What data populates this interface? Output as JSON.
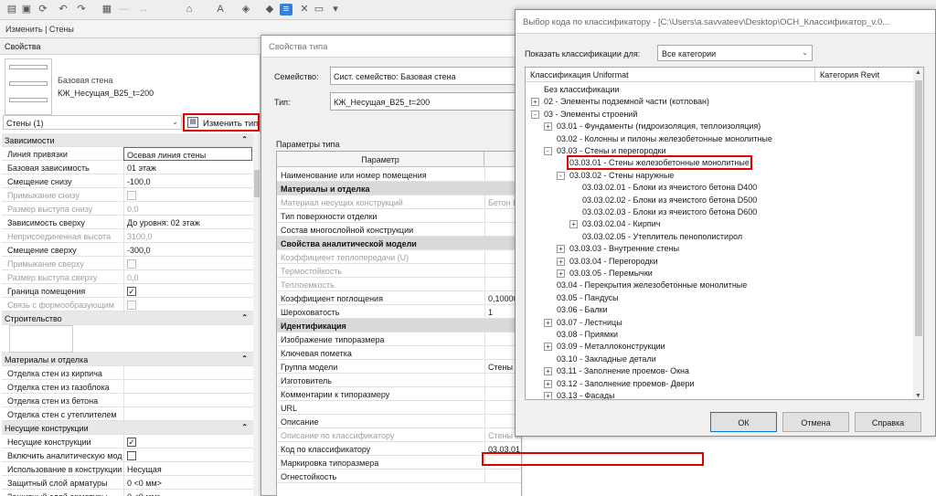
{
  "toolbar": {
    "icons": [
      "open-icon",
      "save-icon",
      "sync-icon",
      "undo-icon",
      "redo-icon",
      "print-icon",
      "measure-icon",
      "dimension-icon",
      "tag-icon",
      "text-icon",
      "3d-icon",
      "section-icon",
      "thin-lines-icon",
      "close-hidden-icon",
      "switch-windows-icon",
      "dropdown-icon"
    ]
  },
  "ribbon": {
    "label": "Изменить | Стены"
  },
  "properties": {
    "title": "Свойства",
    "family": "Базовая стена",
    "type_name": "КЖ_Несущая_B25_t=200",
    "instance_selector": "Стены (1)",
    "edit_type_label": "Изменить тип",
    "rows": [
      {
        "kind": "section",
        "label": "Зависимости",
        "arrow": "⌃"
      },
      {
        "label": "Линия привязки",
        "value": "Осевая линия стены",
        "boxed": true
      },
      {
        "label": "Базовая зависимость",
        "value": "01 этаж"
      },
      {
        "label": "Смещение снизу",
        "value": "-100,0"
      },
      {
        "label": "Примыкание снизу",
        "value": "",
        "dim": true,
        "check": "dis"
      },
      {
        "label": "Размер выступа снизу",
        "value": "0,0",
        "dim": true
      },
      {
        "label": "Зависимость сверху",
        "value": "До уровня: 02 этаж"
      },
      {
        "label": "Неприсоединенная высота",
        "value": "3100,0",
        "dim": true
      },
      {
        "label": "Смещение сверху",
        "value": "-300,0"
      },
      {
        "label": "Примыкание сверху",
        "value": "",
        "dim": true,
        "check": "dis"
      },
      {
        "label": "Размер выступа сверху",
        "value": "0,0",
        "dim": true
      },
      {
        "label": "Граница помещения",
        "value": "✓",
        "check": "on"
      },
      {
        "label": "Связь с формообразующим",
        "value": "",
        "dim": true,
        "check": "dis"
      },
      {
        "kind": "section",
        "label": "Строительство",
        "arrow": "⌃"
      },
      {
        "kind": "thumb"
      },
      {
        "kind": "section",
        "label": "Материалы и отделка",
        "arrow": "⌃"
      },
      {
        "label": "Отделка стен из кирпича",
        "value": ""
      },
      {
        "label": "Отделка стен из газоблока",
        "value": ""
      },
      {
        "label": "Отделка стен из бетона",
        "value": ""
      },
      {
        "label": "Отделка стен с утеплителем",
        "value": ""
      },
      {
        "kind": "section",
        "label": "Несущие конструкции",
        "arrow": "⌃"
      },
      {
        "label": "Несущие конструкции",
        "value": "✓",
        "check": "on"
      },
      {
        "label": "Включить аналитическую модель",
        "value": "",
        "check": "off"
      },
      {
        "label": "Использование в конструкции",
        "value": "Несущая"
      },
      {
        "label": "Защитный слой арматуры",
        "value": "0 <0 мм>"
      },
      {
        "label": "Защитный слой арматуры",
        "value": "0 <0 мм>"
      }
    ]
  },
  "type_dialog": {
    "title": "Свойства типа",
    "family_label": "Семейство:",
    "family_value": "Сист. семейство: Базовая стена",
    "type_label": "Тип:",
    "type_value": "КЖ_Несущая_B25_t=200",
    "params_label": "Параметры типа",
    "col_param": "Параметр",
    "rows": [
      {
        "label": "Наименование или номер помещения",
        "value": ""
      },
      {
        "kind": "section",
        "label": "Материалы и отделка"
      },
      {
        "label": "Материал несущих конструкций",
        "value": "Бетон Б",
        "dim": true
      },
      {
        "label": "Тип поверхности отделки",
        "value": ""
      },
      {
        "label": "Состав многослойной конструкции",
        "value": ""
      },
      {
        "kind": "section",
        "label": "Свойства аналитической модели"
      },
      {
        "label": "Коэффициент теплопередачи (U)",
        "value": "",
        "dim": true
      },
      {
        "label": "Термостойкость",
        "value": "",
        "dim": true
      },
      {
        "label": "Теплоемкость",
        "value": "",
        "dim": true
      },
      {
        "label": "Коэффициент поглощения",
        "value": "0,10000"
      },
      {
        "label": "Шероховатость",
        "value": "1"
      },
      {
        "kind": "section",
        "label": "Идентификация"
      },
      {
        "label": "Изображение типоразмера",
        "value": ""
      },
      {
        "label": "Ключевая пометка",
        "value": ""
      },
      {
        "label": "Группа модели",
        "value": "Стены"
      },
      {
        "label": "Изготовитель",
        "value": ""
      },
      {
        "label": "Комментарии к типоразмеру",
        "value": ""
      },
      {
        "label": "URL",
        "value": ""
      },
      {
        "label": "Описание",
        "value": ""
      },
      {
        "label": "Описание по классификатору",
        "value": "Стены железобетонные монолитные",
        "dim": true,
        "wide": true
      },
      {
        "label": "Код по классификатору",
        "value": "03.03.01",
        "wide": true
      },
      {
        "label": "Маркировка типоразмера",
        "value": ""
      },
      {
        "label": "Огнестойкость",
        "value": ""
      }
    ]
  },
  "classifier_dialog": {
    "title": "Выбор кода по классификатору - [C:\\Users\\a.savvateev\\Desktop\\ОСН_Классификатор_v.0...",
    "show_label": "Показать классификации для:",
    "category_value": "Все категории",
    "col_uniformat": "Классификация Uniformat",
    "col_category": "Категория Revit",
    "tree": [
      {
        "label": "Без классификации",
        "level": 0,
        "exp": ""
      },
      {
        "label": "02 - Элементы подземной части (котлован)",
        "level": 0,
        "exp": "+"
      },
      {
        "label": "03 - Элементы строений",
        "level": 0,
        "exp": "-"
      },
      {
        "label": "03.01 - Фундаменты (гидроизоляция, теплоизоляция)",
        "level": 1,
        "exp": "+"
      },
      {
        "label": "03.02 - Колонны и пилоны железобетонные монолитные",
        "level": 1,
        "exp": ""
      },
      {
        "label": "03.03 - Стены и перегородки",
        "level": 1,
        "exp": "-"
      },
      {
        "label": "03.03.01 - Стены железобетонные монолитные",
        "level": 2,
        "exp": "",
        "selected": true
      },
      {
        "label": "03.03.02 - Стены наружные",
        "level": 2,
        "exp": "-"
      },
      {
        "label": "03.03.02.01 - Блоки из ячеистого бетона D400",
        "level": 3,
        "exp": ""
      },
      {
        "label": "03.03.02.02 - Блоки из ячеистого бетона D500",
        "level": 3,
        "exp": ""
      },
      {
        "label": "03.03.02.03 - Блоки из ячеистого бетона D600",
        "level": 3,
        "exp": ""
      },
      {
        "label": "03.03.02.04 - Кирпич",
        "level": 3,
        "exp": "+"
      },
      {
        "label": "03.03.02.05 - Утеплитель пенополистирол",
        "level": 3,
        "exp": ""
      },
      {
        "label": "03.03.03 - Внутренние стены",
        "level": 2,
        "exp": "+"
      },
      {
        "label": "03.03.04 - Перегородки",
        "level": 2,
        "exp": "+"
      },
      {
        "label": "03.03.05 - Перемычки",
        "level": 2,
        "exp": "+"
      },
      {
        "label": "03.04 - Перекрытия железобетонные монолитные",
        "level": 1,
        "exp": ""
      },
      {
        "label": "03.05 - Пандусы",
        "level": 1,
        "exp": ""
      },
      {
        "label": "03.06 - Балки",
        "level": 1,
        "exp": ""
      },
      {
        "label": "03.07 - Лестницы",
        "level": 1,
        "exp": "+"
      },
      {
        "label": "03.08 - Приямки",
        "level": 1,
        "exp": ""
      },
      {
        "label": "03.09 - Металлоконструкции",
        "level": 1,
        "exp": "+"
      },
      {
        "label": "03.10 - Закладные детали",
        "level": 1,
        "exp": ""
      },
      {
        "label": "03.11 - Заполнение проемов- Окна",
        "level": 1,
        "exp": "+"
      },
      {
        "label": "03.12 - Заполнение проемов- Двери",
        "level": 1,
        "exp": "+"
      },
      {
        "label": "03.13 - Фасады",
        "level": 1,
        "exp": "+"
      }
    ],
    "ok_label": "ОК",
    "cancel_label": "Отмена",
    "help_label": "Справка"
  }
}
